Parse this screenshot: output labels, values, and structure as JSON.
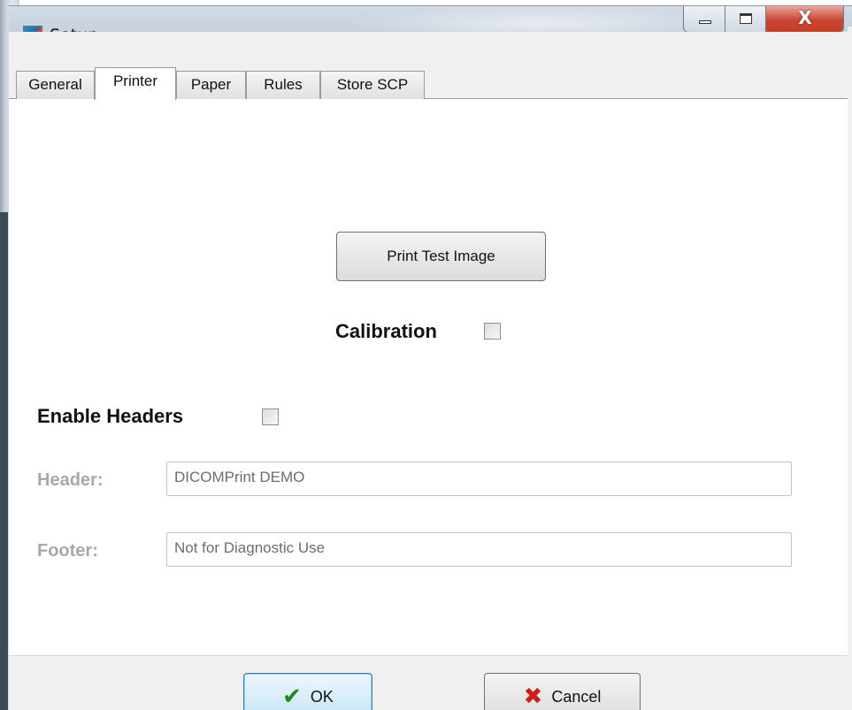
{
  "window": {
    "title": "Setup",
    "app_icon_text": "PS",
    "close_glyph": "X"
  },
  "tabs": [
    {
      "label": "General",
      "active": false
    },
    {
      "label": "Printer",
      "active": true
    },
    {
      "label": "Paper",
      "active": false
    },
    {
      "label": "Rules",
      "active": false
    },
    {
      "label": "Store SCP",
      "active": false
    }
  ],
  "printer": {
    "print_test_label": "Print Test Image",
    "calibration_label": "Calibration",
    "calibration_checked": false,
    "enable_headers_label": "Enable Headers",
    "enable_headers_checked": false,
    "header_label": "Header:",
    "header_value": "DICOMPrint DEMO",
    "footer_label": "Footer:",
    "footer_value": "Not for Diagnostic Use"
  },
  "footer": {
    "ok_label": "OK",
    "ok_icon": "check-icon",
    "cancel_label": "Cancel",
    "cancel_icon": "x-icon"
  },
  "colors": {
    "ok_icon": "#1e8a1e",
    "cancel_icon": "#c8221a",
    "disabled_text": "#a8a8a8",
    "close_button": "#c94531"
  }
}
